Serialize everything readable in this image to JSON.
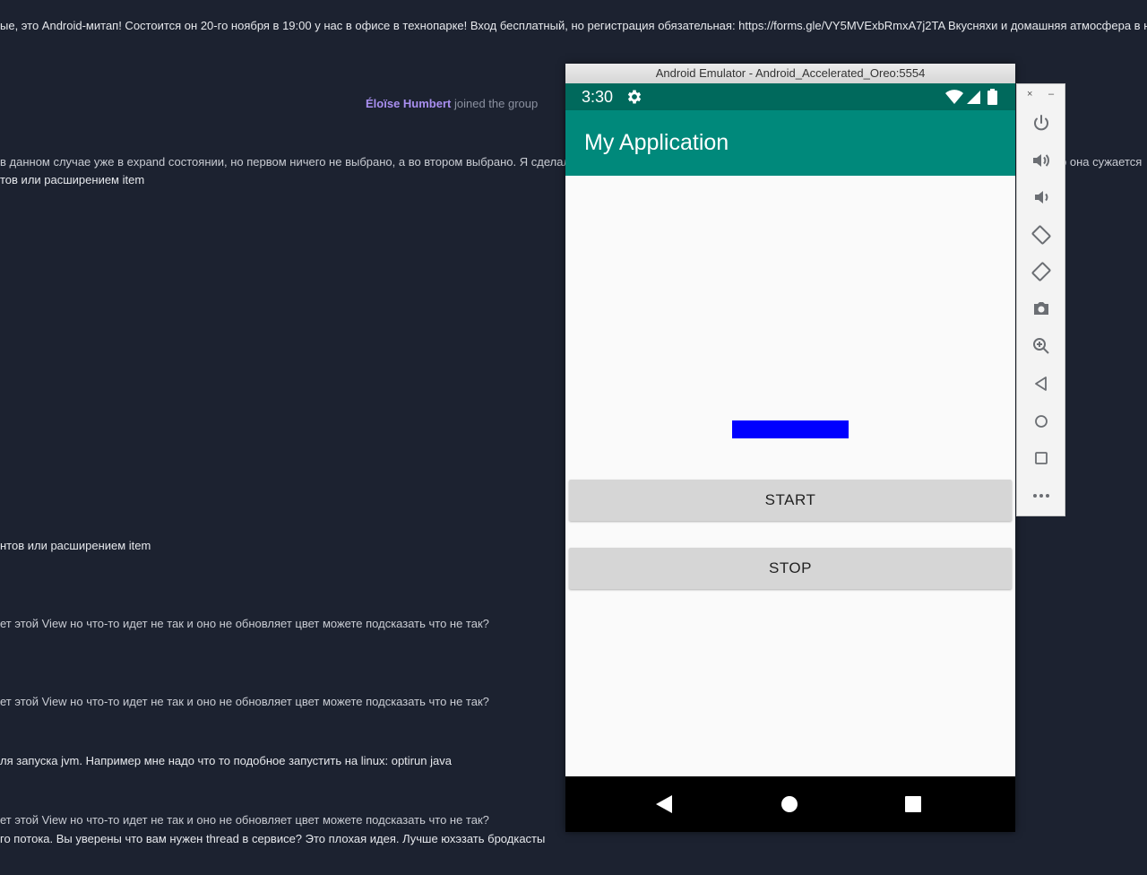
{
  "chat": {
    "announcement": "ые, это Android-митап! Состоится он 20-го ноября в 19:00 у нас в офисе в технопарке! Вход бесплатный, но регистрация обязательная:  https://forms.gle/VY5MVExbRmxA7j2TA  Вкусняхи и домашняя атмосфера в на",
    "join_name": "Éloïse Humbert",
    "join_text": " joined the group",
    "line_expand_left": "в данном случае уже в expand состоянии, но первом ничего не выбрано, а во втором выбрано. Я сделал",
    "line_expand_right": "р она сужается",
    "line_items_1": "тов или расширением item",
    "line_items_2": "нтов или расширением item",
    "line_view_1": "ет этой View но что-то идет не так и оно не обновляет цвет можете подсказать что не так?",
    "line_view_2": "ет этой View но что-то идет не так и оно не обновляет цвет можете подсказать что не так?",
    "line_jvm": "ля запуска jvm. Например мне надо что то подобное запустить на linux: optirun java",
    "line_view_3": "ет этой View но что-то идет не так и оно не обновляет цвет можете подсказать что не так?",
    "line_thread": "го потока. Вы уверены что вам нужен thread в сервисе? Это плохая идея. Лучше юхэзать бродкасты"
  },
  "emulator": {
    "window_title": "Android Emulator - Android_Accelerated_Oreo:5554",
    "status_time": "3:30",
    "app_title": "My Application",
    "start_label": "START",
    "stop_label": "STOP",
    "colors": {
      "status_bar": "#00695c",
      "app_bar": "#00897b",
      "blue_view": "#0000ff",
      "button": "#d6d6d6"
    }
  },
  "toolbar": {
    "close_label": "×",
    "min_label": "–",
    "tools": [
      "power-icon",
      "volume-up-icon",
      "volume-down-icon",
      "rotate-left-icon",
      "rotate-right-icon",
      "camera-icon",
      "zoom-icon",
      "back-icon",
      "home-icon",
      "overview-icon",
      "more-icon"
    ]
  }
}
